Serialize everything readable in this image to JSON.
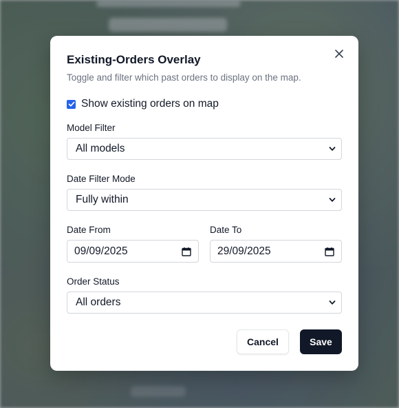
{
  "modal": {
    "title": "Existing-Orders Overlay",
    "subtitle": "Toggle and filter which past orders to display on the map.",
    "show_orders": {
      "label": "Show existing orders on map",
      "checked": true
    },
    "model_filter": {
      "label": "Model Filter",
      "value": "All models"
    },
    "date_filter_mode": {
      "label": "Date Filter Mode",
      "value": "Fully within"
    },
    "date_from": {
      "label": "Date From",
      "value": "09/09/2025"
    },
    "date_to": {
      "label": "Date To",
      "value": "29/09/2025"
    },
    "order_status": {
      "label": "Order Status",
      "value": "All orders"
    },
    "buttons": {
      "cancel": "Cancel",
      "save": "Save"
    }
  },
  "colors": {
    "accent": "#2563eb",
    "primary_button": "#111827"
  },
  "icons": {
    "close": "close-icon",
    "chevron": "chevron-down-icon",
    "calendar": "calendar-icon",
    "check": "check-icon"
  }
}
